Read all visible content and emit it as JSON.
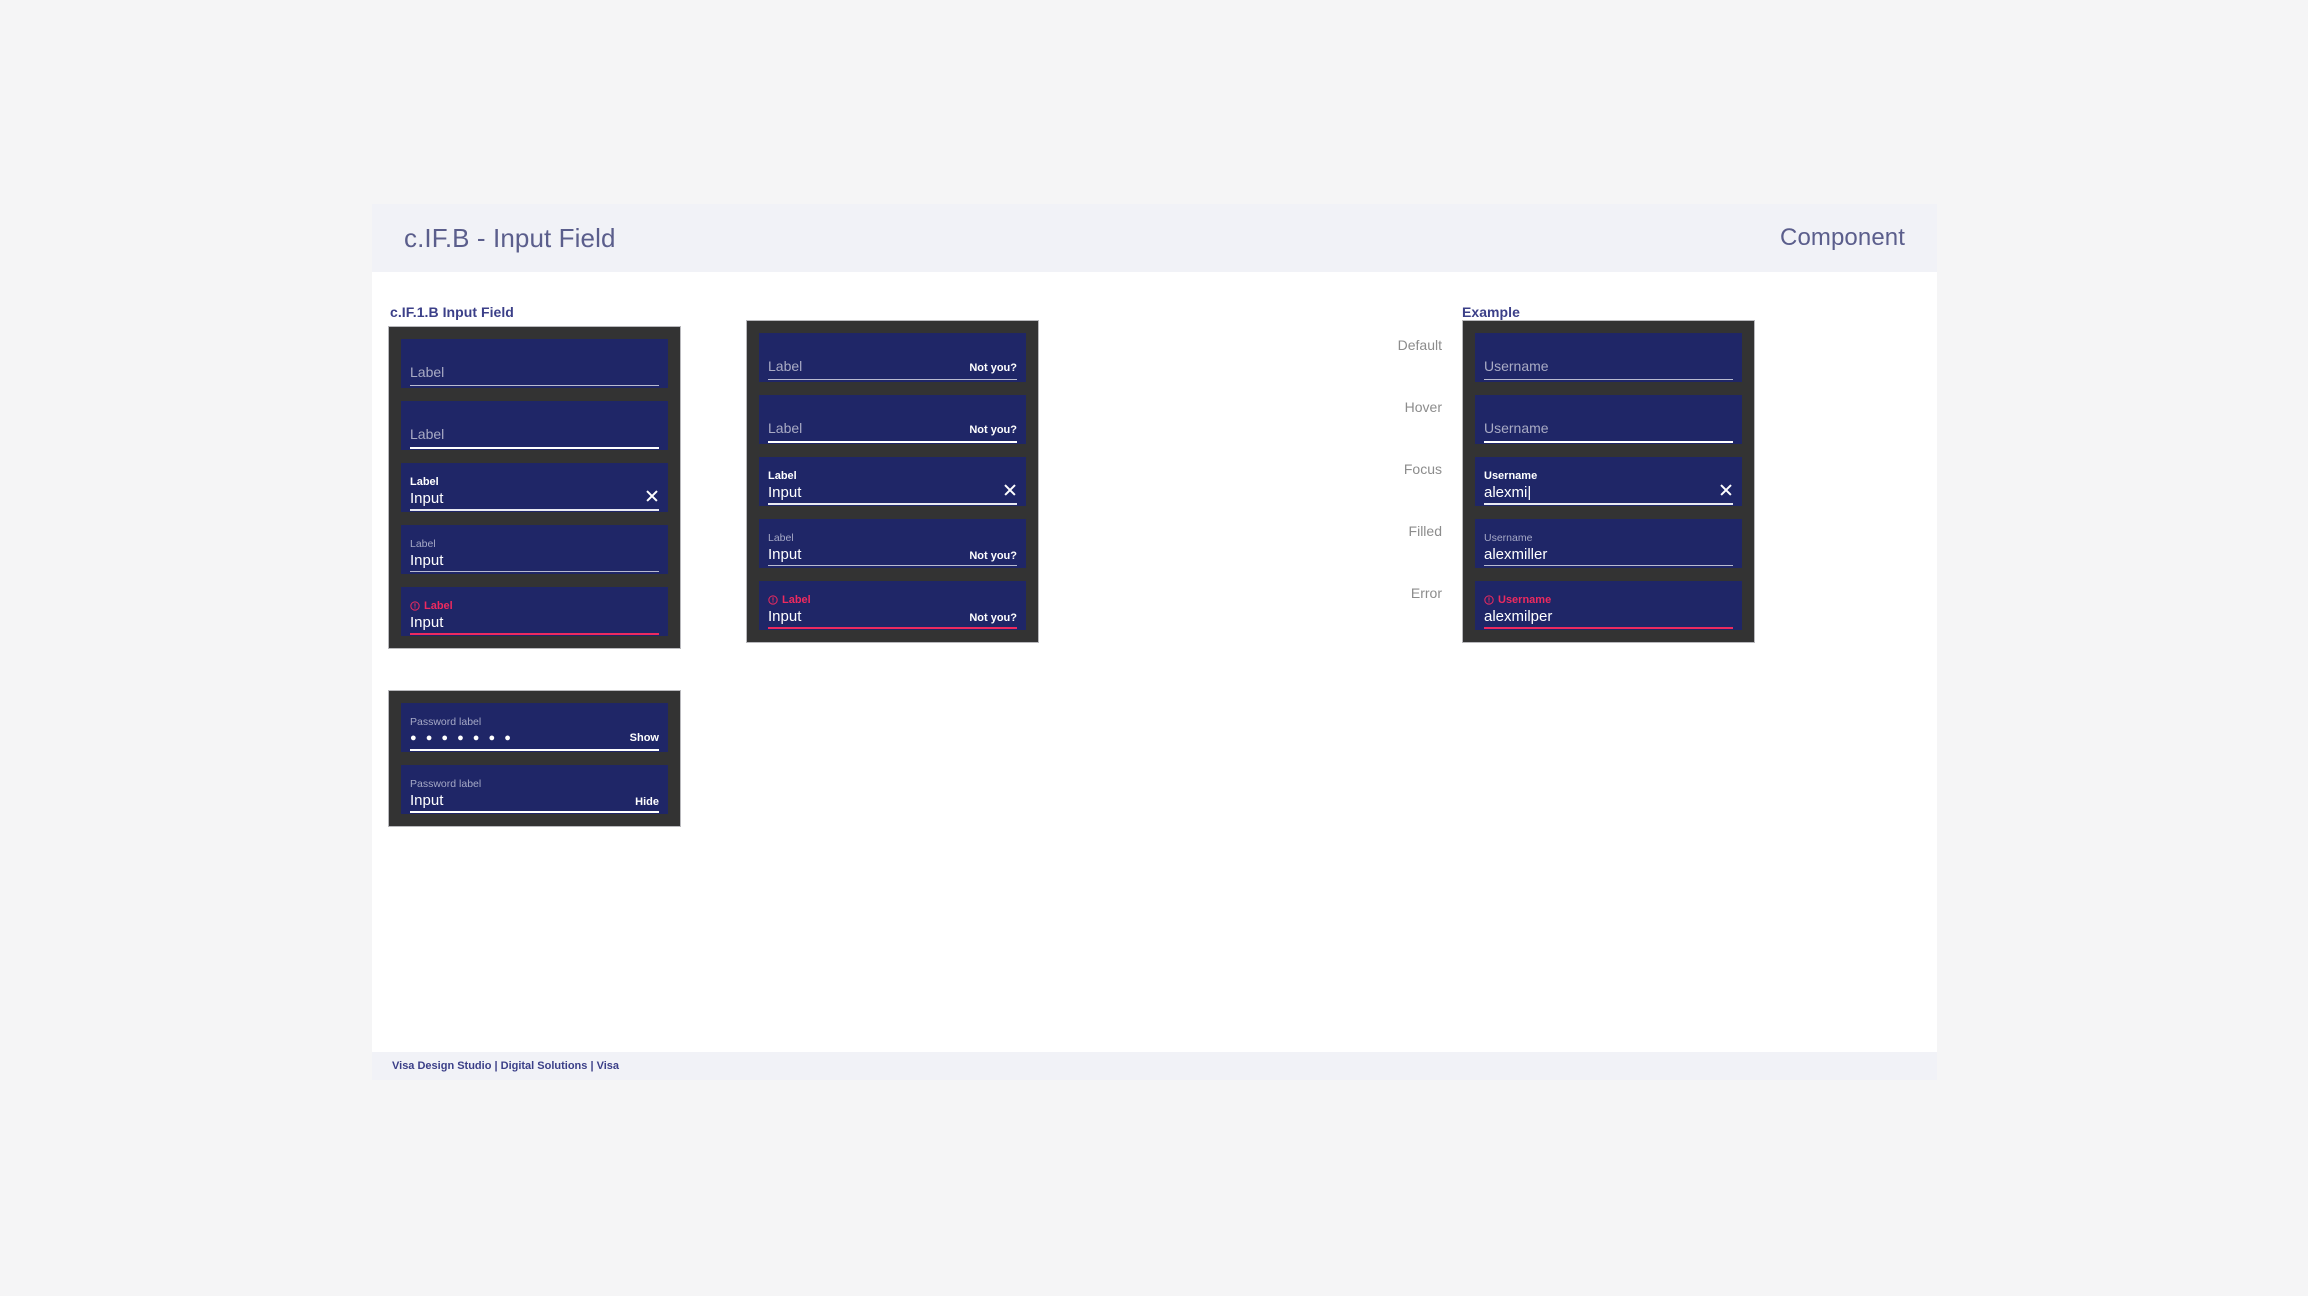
{
  "header": {
    "title": "c.IF.B - Input Field",
    "kind": "Component"
  },
  "sections": {
    "spec_label": "c.IF.1.B Input Field",
    "example_label": "Example"
  },
  "states": [
    "Default",
    "Hover",
    "Focus",
    "Filled",
    "Error"
  ],
  "colors": {
    "field_bg": "#1f2667",
    "card_bg": "#333333",
    "error": "#ed2a5f",
    "accent": "#3b3f88",
    "header_bg": "#f1f2f7",
    "underline": "#b9bbd0",
    "underline_active": "#ffffff"
  },
  "icons": {
    "clear": "close-x-icon",
    "error": "error-circle-icon"
  },
  "card_basic": {
    "fields": [
      {
        "state": "Default",
        "label": "Label",
        "value": "",
        "trailing": ""
      },
      {
        "state": "Hover",
        "label": "Label",
        "value": "",
        "trailing": ""
      },
      {
        "state": "Focus",
        "label": "Label",
        "value": "Input",
        "trailing": ""
      },
      {
        "state": "Filled",
        "label": "Label",
        "value": "Input",
        "trailing": ""
      },
      {
        "state": "Error",
        "label": "Label",
        "value": "Input",
        "trailing": ""
      }
    ]
  },
  "card_trailing": {
    "trailing_label": "Not you?",
    "fields": [
      {
        "state": "Default",
        "label": "Label",
        "value": "",
        "trailing": "Not you?"
      },
      {
        "state": "Hover",
        "label": "Label",
        "value": "",
        "trailing": "Not you?"
      },
      {
        "state": "Focus",
        "label": "Label",
        "value": "Input",
        "trailing": ""
      },
      {
        "state": "Filled",
        "label": "Label",
        "value": "Input",
        "trailing": "Not you?"
      },
      {
        "state": "Error",
        "label": "Label",
        "value": "Input",
        "trailing": "Not you?"
      }
    ]
  },
  "card_example": {
    "fields": [
      {
        "state": "Default",
        "label": "Username",
        "value": ""
      },
      {
        "state": "Hover",
        "label": "Username",
        "value": ""
      },
      {
        "state": "Focus",
        "label": "Username",
        "value": "alexmi|"
      },
      {
        "state": "Filled",
        "label": "Username",
        "value": "alexmiller"
      },
      {
        "state": "Error",
        "label": "Username",
        "value": "alexmilper"
      }
    ]
  },
  "card_password": {
    "fields": [
      {
        "state": "Masked",
        "label": "Password label",
        "value": "● ● ● ● ● ● ●",
        "trailing": "Show"
      },
      {
        "state": "Visible",
        "label": "Password label",
        "value": "Input",
        "trailing": "Hide"
      }
    ]
  },
  "footer": {
    "text": "Visa Design Studio | Digital Solutions | Visa"
  }
}
